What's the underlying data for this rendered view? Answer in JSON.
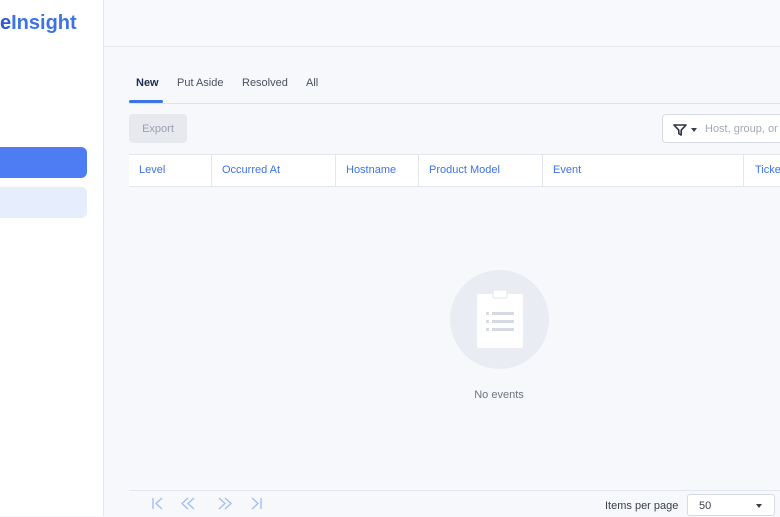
{
  "app": {
    "brand_pre": "e",
    "brand_post": "Insight"
  },
  "tabs": [
    {
      "label": "New",
      "active": true
    },
    {
      "label": "Put Aside",
      "active": false
    },
    {
      "label": "Resolved",
      "active": false
    },
    {
      "label": "All",
      "active": false
    }
  ],
  "toolbar": {
    "export_label": "Export",
    "search_placeholder": "Host, group, or"
  },
  "table": {
    "columns": [
      "Level",
      "Occurred At",
      "Hostname",
      "Product Model",
      "Event",
      "Ticket"
    ]
  },
  "empty_state": {
    "text": "No events"
  },
  "pagination": {
    "first_icon": "first-page-icon",
    "prev_icon": "previous-page-icon",
    "next_icon": "next-page-icon",
    "last_icon": "last-page-icon",
    "items_per_page_label": "Items per page",
    "items_per_page_value": "50"
  },
  "colors": {
    "accent": "#3d73e6",
    "nav_active": "#4d7cf3",
    "nav_hover": "#e6edfd"
  }
}
